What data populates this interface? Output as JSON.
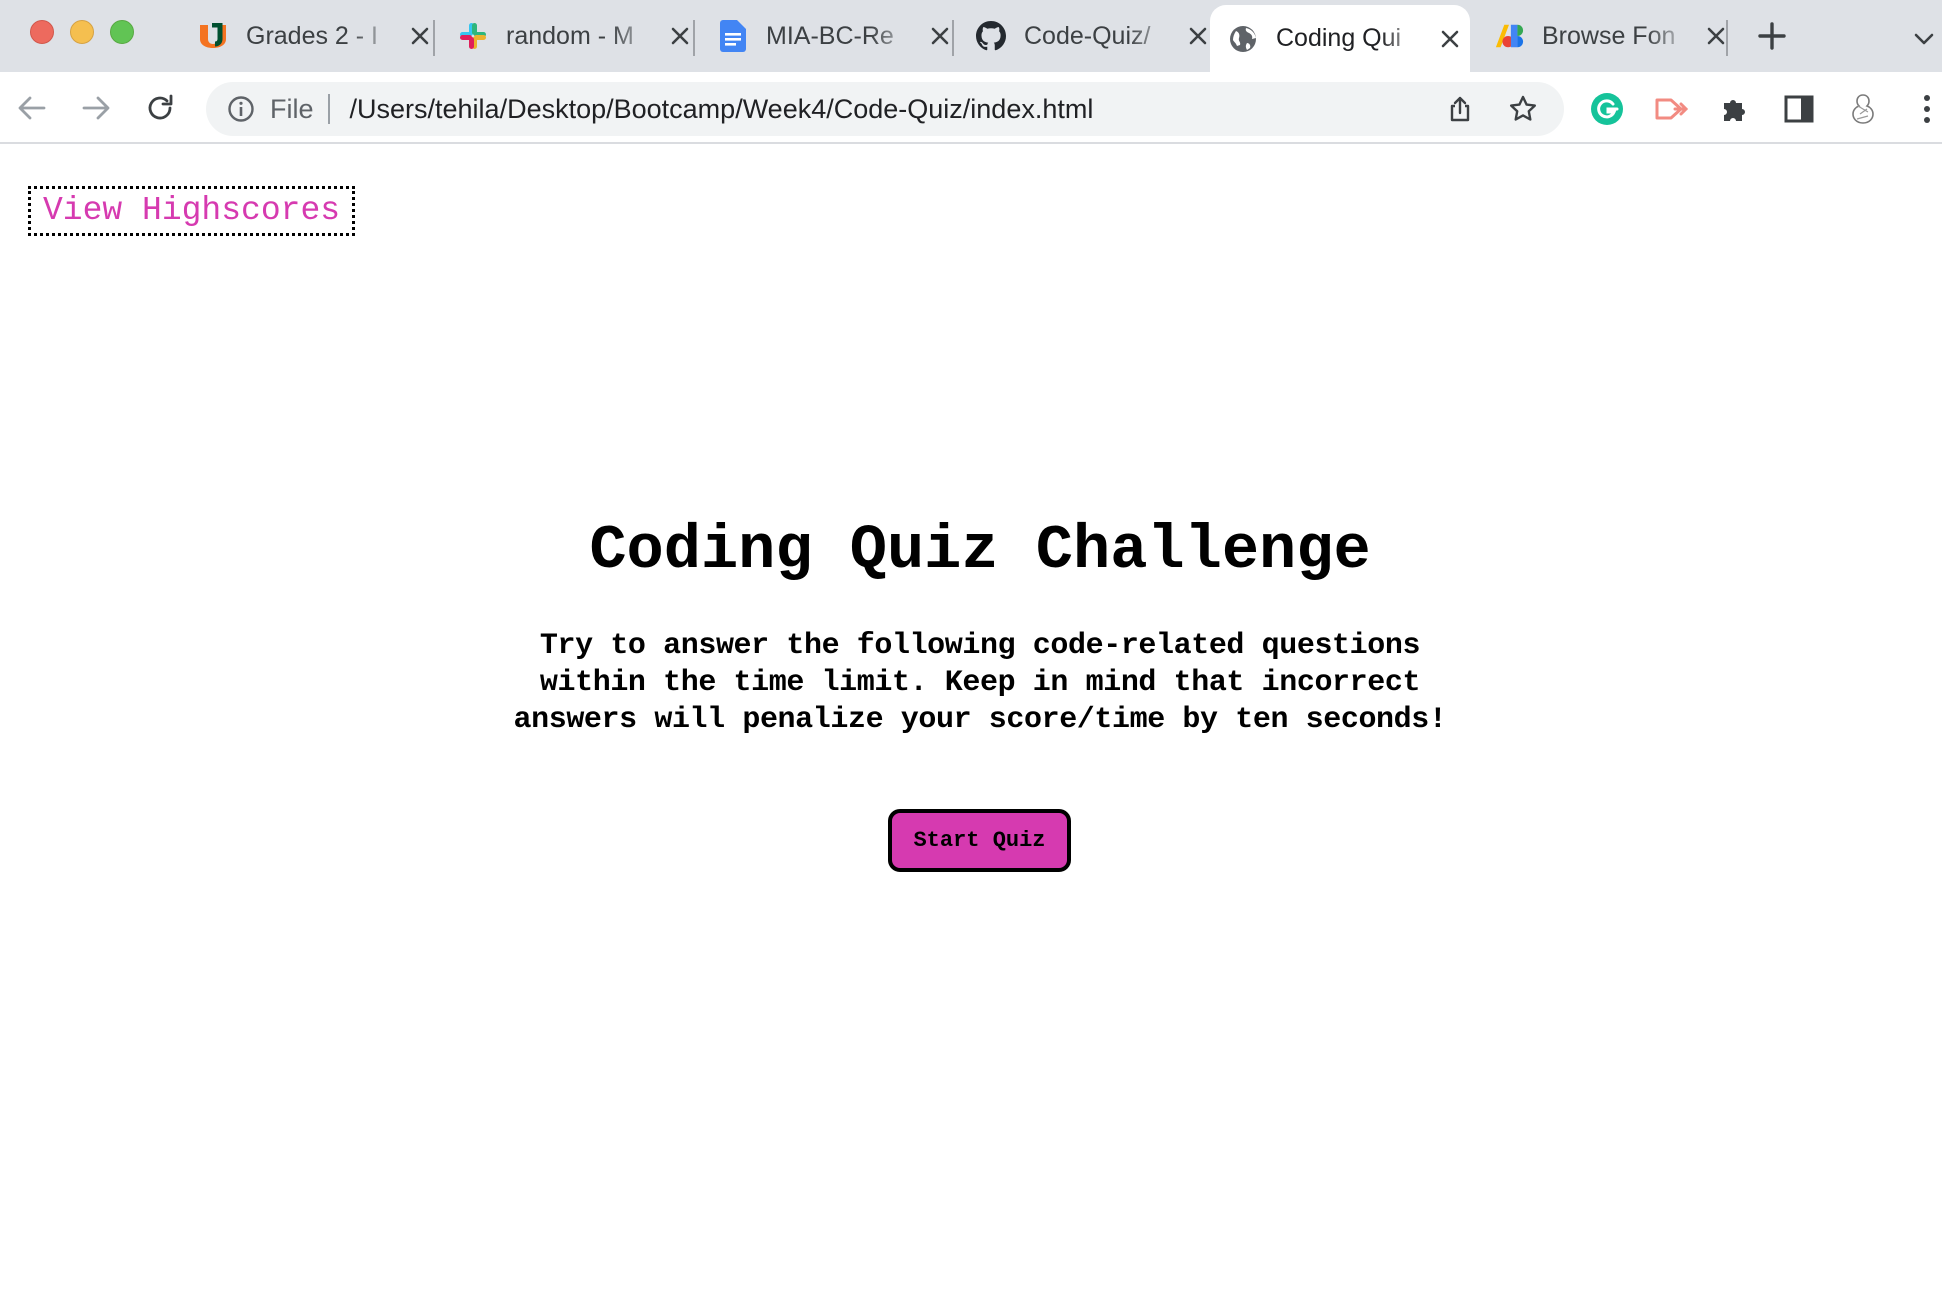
{
  "window": {
    "tabs": [
      {
        "title": "Grades 2 - I",
        "favicon": "university-u-icon",
        "active": false
      },
      {
        "title": "random - M",
        "favicon": "slack-icon",
        "active": false
      },
      {
        "title": "MIA-BC-Re",
        "favicon": "docs-icon",
        "active": false
      },
      {
        "title": "Code-Quiz/",
        "favicon": "github-icon",
        "active": false
      },
      {
        "title": "Coding Qui",
        "favicon": "globe-icon",
        "active": true
      },
      {
        "title": "Browse Fon",
        "favicon": "google-fonts-icon",
        "active": false
      }
    ]
  },
  "toolbar": {
    "scheme_label": "File",
    "url": "/Users/tehila/Desktop/Bootcamp/Week4/Code-Quiz/index.html",
    "extensions": [
      "grammarly-icon",
      "cast-extension-icon",
      "puzzle-extensions-icon",
      "side-panel-icon",
      "profile-avatar-icon"
    ]
  },
  "page": {
    "highscores_link": "View Highscores",
    "title": "Coding Quiz Challenge",
    "description": "Try to answer the following code-related questions within the time limit. Keep in mind that incorrect answers will penalize your score/time by ten seconds!",
    "start_button": "Start Quiz"
  },
  "colors": {
    "accent": "#d63ab0",
    "tabbar": "#dee1e6",
    "omnibox": "#f1f3f4"
  }
}
